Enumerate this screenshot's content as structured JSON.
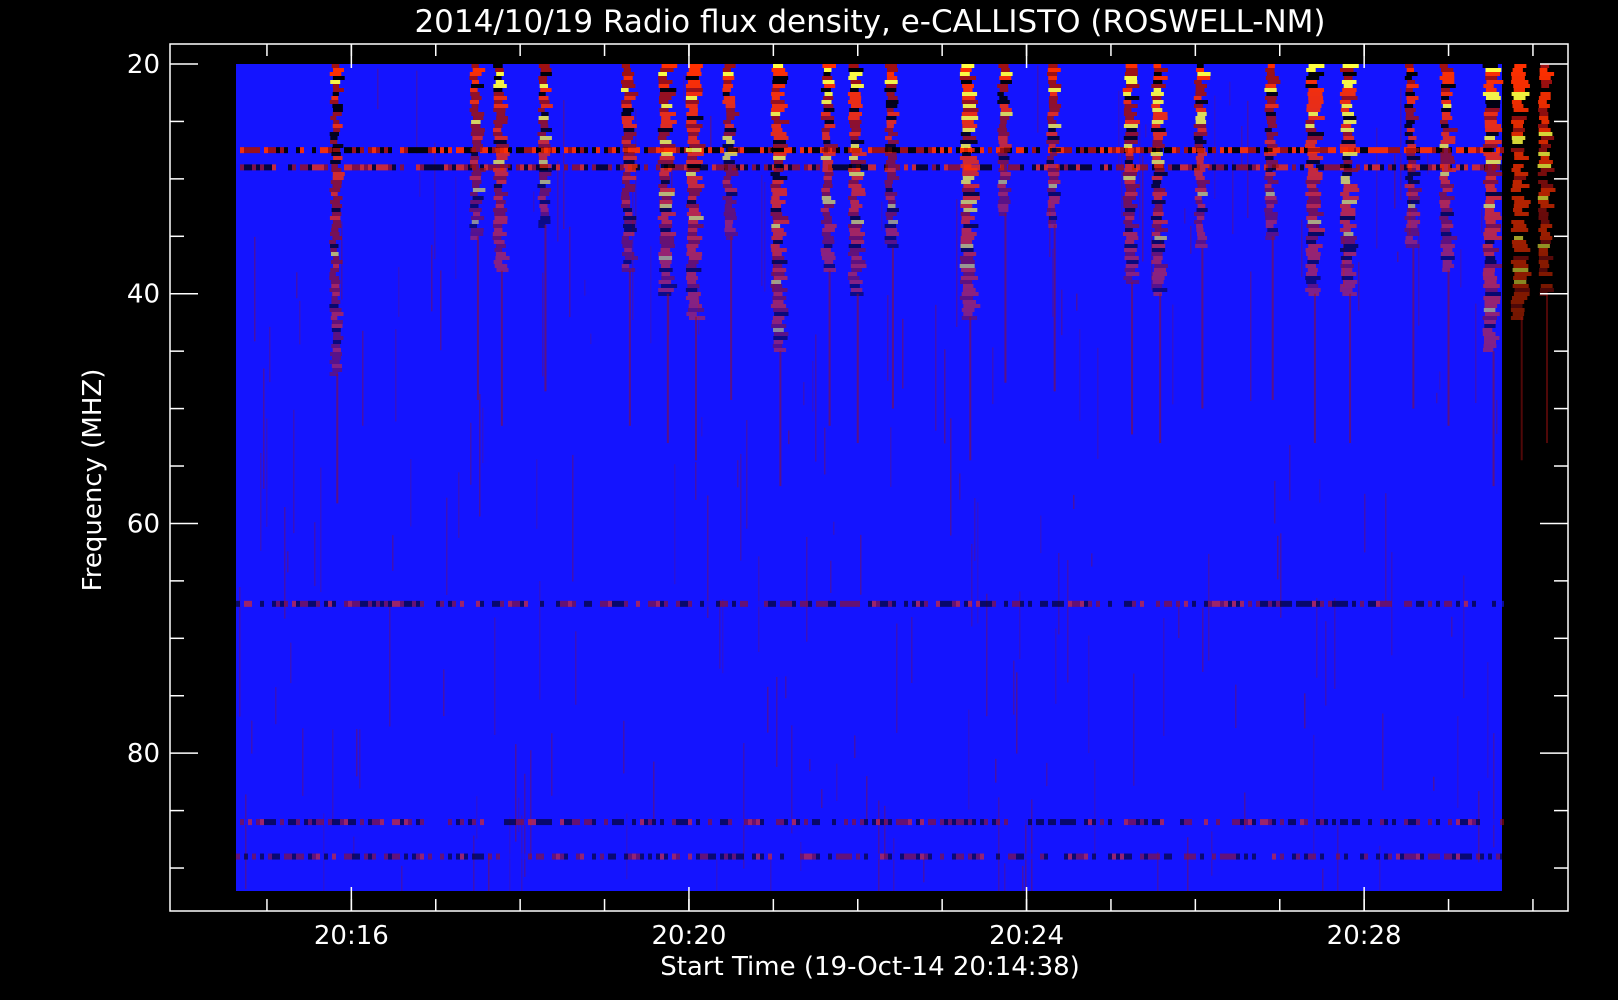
{
  "chart_data": {
    "type": "heatmap",
    "title": "2014/10/19  Radio flux density, e-CALLISTO (ROSWELL-NM)",
    "xlabel": "Start Time (19-Oct-14 20:14:38)",
    "ylabel": "Frequency (MHZ)",
    "x_unit": "time (HH:MM, UTC)",
    "x_range": [
      "20:14:38",
      "20:29:38"
    ],
    "x_ticks": [
      {
        "label": "20:16",
        "value": "20:16"
      },
      {
        "label": "20:20",
        "value": "20:20"
      },
      {
        "label": "20:24",
        "value": "20:24"
      },
      {
        "label": "20:28",
        "value": "20:28"
      }
    ],
    "y_range": [
      20,
      92
    ],
    "y_inverted": true,
    "y_ticks": [
      {
        "label": "20",
        "value": 20
      },
      {
        "label": "40",
        "value": 40
      },
      {
        "label": "60",
        "value": 60
      },
      {
        "label": "80",
        "value": 80
      }
    ],
    "colormap": [
      "#000000",
      "#1414ff",
      "#a01010",
      "#ff3000",
      "#ffff40"
    ],
    "background_color": "#1414ff",
    "bursts": [
      {
        "time": "20:15:50",
        "f_max": 47,
        "intensity": 0.4
      },
      {
        "time": "20:17:30",
        "f_max": 35,
        "intensity": 0.55
      },
      {
        "time": "20:17:47",
        "f_max": 38,
        "intensity": 0.65
      },
      {
        "time": "20:18:18",
        "f_max": 34,
        "intensity": 0.45
      },
      {
        "time": "20:19:18",
        "f_max": 38,
        "intensity": 0.6
      },
      {
        "time": "20:19:45",
        "f_max": 40,
        "intensity": 0.85
      },
      {
        "time": "20:20:05",
        "f_max": 42,
        "intensity": 0.9
      },
      {
        "time": "20:20:30",
        "f_max": 35,
        "intensity": 0.55
      },
      {
        "time": "20:21:05",
        "f_max": 45,
        "intensity": 0.8
      },
      {
        "time": "20:21:40",
        "f_max": 38,
        "intensity": 0.6
      },
      {
        "time": "20:22:00",
        "f_max": 40,
        "intensity": 0.8
      },
      {
        "time": "20:22:25",
        "f_max": 36,
        "intensity": 0.5
      },
      {
        "time": "20:23:20",
        "f_max": 42,
        "intensity": 0.95
      },
      {
        "time": "20:23:45",
        "f_max": 33,
        "intensity": 0.45
      },
      {
        "time": "20:24:20",
        "f_max": 34,
        "intensity": 0.5
      },
      {
        "time": "20:25:15",
        "f_max": 39,
        "intensity": 0.7
      },
      {
        "time": "20:25:35",
        "f_max": 40,
        "intensity": 0.7
      },
      {
        "time": "20:26:05",
        "f_max": 36,
        "intensity": 0.55
      },
      {
        "time": "20:26:55",
        "f_max": 35,
        "intensity": 0.55
      },
      {
        "time": "20:27:25",
        "f_max": 40,
        "intensity": 0.85
      },
      {
        "time": "20:27:50",
        "f_max": 40,
        "intensity": 0.85
      },
      {
        "time": "20:28:35",
        "f_max": 36,
        "intensity": 0.6
      },
      {
        "time": "20:29:00",
        "f_max": 38,
        "intensity": 0.7
      },
      {
        "time": "20:29:32",
        "f_max": 45,
        "intensity": 1.0
      },
      {
        "time": "20:29:52",
        "f_max": 42,
        "intensity": 1.0
      },
      {
        "time": "20:30:10",
        "f_max": 40,
        "intensity": 0.7
      }
    ],
    "horizontal_bands": [
      {
        "frequency": 27.5,
        "intensity": 0.9
      },
      {
        "frequency": 29,
        "intensity": 0.6
      },
      {
        "frequency": 67,
        "intensity": 0.3
      },
      {
        "frequency": 86,
        "intensity": 0.3
      },
      {
        "frequency": 89,
        "intensity": 0.25
      }
    ]
  }
}
